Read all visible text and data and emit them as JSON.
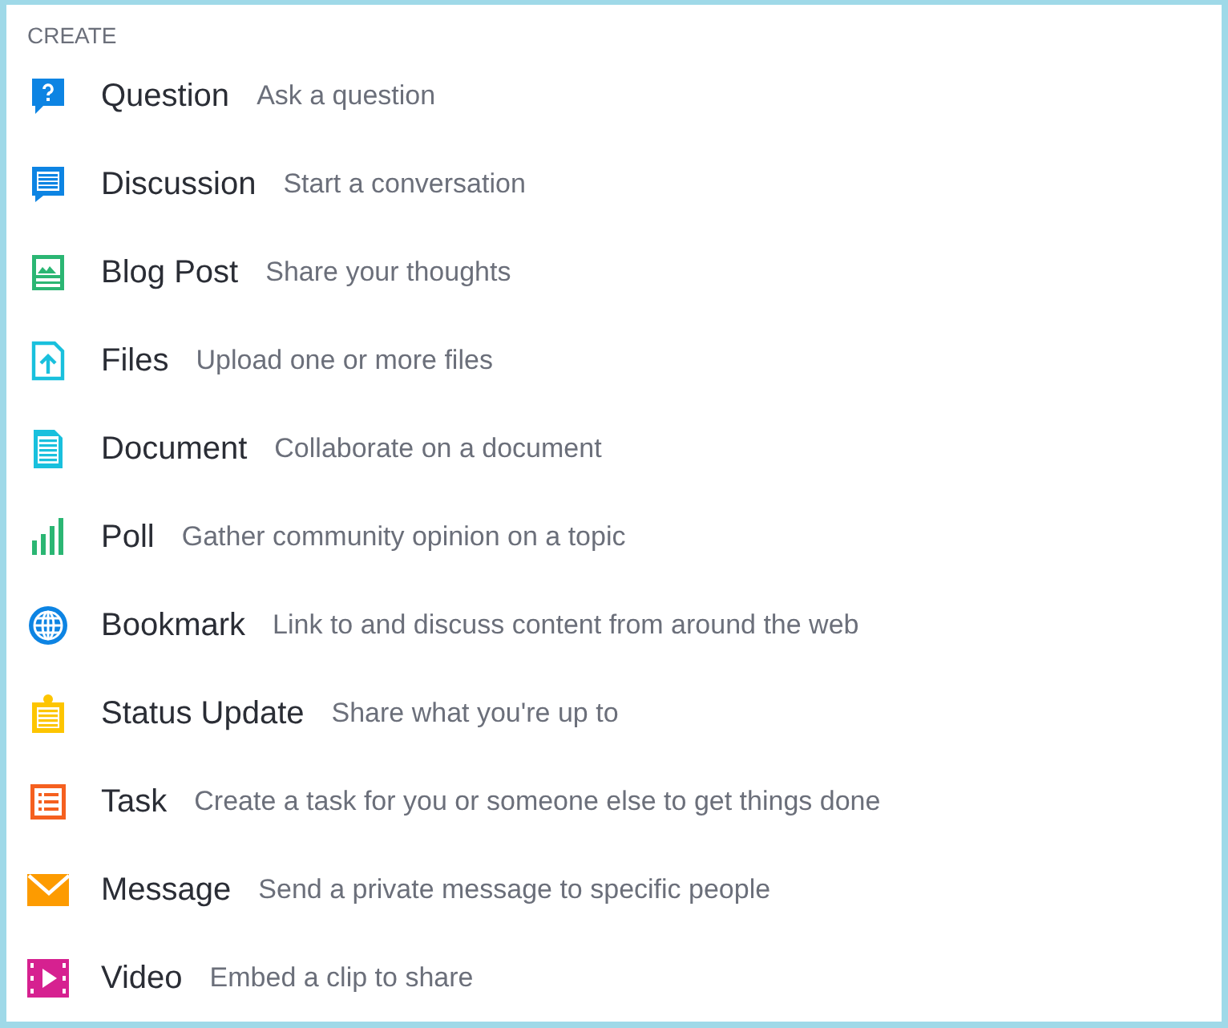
{
  "heading": "CREATE",
  "items": [
    {
      "kind": "question",
      "label": "Question",
      "description": "Ask a question"
    },
    {
      "kind": "discussion",
      "label": "Discussion",
      "description": "Start a conversation"
    },
    {
      "kind": "blog",
      "label": "Blog Post",
      "description": "Share your thoughts"
    },
    {
      "kind": "files",
      "label": "Files",
      "description": "Upload one or more files"
    },
    {
      "kind": "document",
      "label": "Document",
      "description": "Collaborate on a document"
    },
    {
      "kind": "poll",
      "label": "Poll",
      "description": "Gather community opinion on a topic"
    },
    {
      "kind": "bookmark",
      "label": "Bookmark",
      "description": "Link to and discuss content from around the web"
    },
    {
      "kind": "status",
      "label": "Status Update",
      "description": "Share what you're up to"
    },
    {
      "kind": "task",
      "label": "Task",
      "description": "Create a task for you or someone else to get things done"
    },
    {
      "kind": "message",
      "label": "Message",
      "description": "Send a private message to specific people"
    },
    {
      "kind": "video",
      "label": "Video",
      "description": "Embed a clip to share"
    }
  ]
}
